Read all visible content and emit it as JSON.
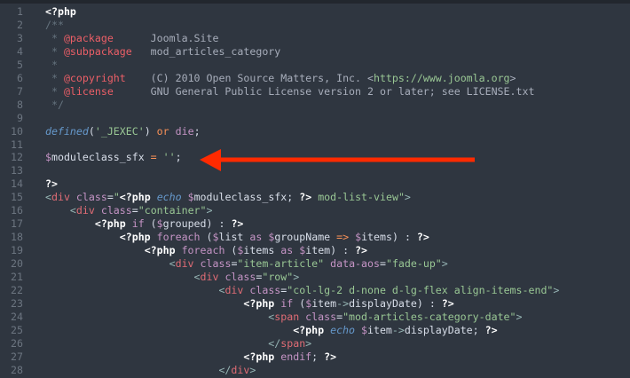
{
  "editor": {
    "line_numbers": [
      "1",
      "2",
      "3",
      "4",
      "5",
      "6",
      "7",
      "8",
      "9",
      "10",
      "11",
      "12",
      "13",
      "14",
      "15",
      "16",
      "17",
      "18",
      "19",
      "20",
      "21",
      "22",
      "23",
      "24",
      "25",
      "26",
      "27",
      "28"
    ],
    "lines": [
      [
        [
          "w",
          "<?php"
        ]
      ],
      [
        [
          "c",
          "/**"
        ]
      ],
      [
        [
          "c",
          " * "
        ],
        [
          "ct",
          "@package"
        ],
        [
          "cv",
          "      Joomla.Site"
        ]
      ],
      [
        [
          "c",
          " * "
        ],
        [
          "ct",
          "@subpackage"
        ],
        [
          "cv",
          "   mod_articles_category"
        ]
      ],
      [
        [
          "c",
          " *"
        ]
      ],
      [
        [
          "c",
          " * "
        ],
        [
          "ct",
          "@copyright"
        ],
        [
          "cv",
          "    (C) 2010 Open Source Matters, Inc. <"
        ],
        [
          "s",
          "https://www.joomla.org"
        ],
        [
          "cv",
          ">"
        ]
      ],
      [
        [
          "c",
          " * "
        ],
        [
          "ct",
          "@license"
        ],
        [
          "cv",
          "      GNU General Public License version 2 or later; see LICENSE.txt"
        ]
      ],
      [
        [
          "c",
          " */"
        ]
      ],
      [],
      [
        [
          "f",
          "defined"
        ],
        [
          "n",
          "("
        ],
        [
          "s",
          "'_JEXEC'"
        ],
        [
          "n",
          ") "
        ],
        [
          "o",
          "or"
        ],
        [
          "n",
          " "
        ],
        [
          "k",
          "die"
        ],
        [
          "n",
          ";"
        ]
      ],
      [],
      [
        [
          "v",
          "$"
        ],
        [
          "n",
          "moduleclass_sfx "
        ],
        [
          "o",
          "="
        ],
        [
          "n",
          " "
        ],
        [
          "s",
          "''"
        ],
        [
          "n",
          ";"
        ]
      ],
      [],
      [
        [
          "w",
          "?>"
        ]
      ],
      [
        [
          "p",
          "<"
        ],
        [
          "t",
          "div"
        ],
        [
          "n",
          " "
        ],
        [
          "a",
          "class"
        ],
        [
          "n",
          "="
        ],
        [
          "s",
          "\""
        ],
        [
          "w",
          "<?php"
        ],
        [
          "n",
          " "
        ],
        [
          "f",
          "echo"
        ],
        [
          "n",
          " "
        ],
        [
          "v",
          "$"
        ],
        [
          "n",
          "moduleclass_sfx; "
        ],
        [
          "w",
          "?>"
        ],
        [
          "s",
          " mod-list-view\""
        ],
        [
          "p",
          ">"
        ]
      ],
      [
        [
          "n",
          "    "
        ],
        [
          "p",
          "<"
        ],
        [
          "t",
          "div"
        ],
        [
          "n",
          " "
        ],
        [
          "a",
          "class"
        ],
        [
          "n",
          "="
        ],
        [
          "s",
          "\"container\""
        ],
        [
          "p",
          ">"
        ]
      ],
      [
        [
          "n",
          "        "
        ],
        [
          "w",
          "<?php"
        ],
        [
          "n",
          " "
        ],
        [
          "k",
          "if"
        ],
        [
          "n",
          " ("
        ],
        [
          "v",
          "$"
        ],
        [
          "n",
          "grouped) : "
        ],
        [
          "w",
          "?>"
        ]
      ],
      [
        [
          "n",
          "            "
        ],
        [
          "w",
          "<?php"
        ],
        [
          "n",
          " "
        ],
        [
          "k",
          "foreach"
        ],
        [
          "n",
          " ("
        ],
        [
          "v",
          "$"
        ],
        [
          "n",
          "list "
        ],
        [
          "k",
          "as"
        ],
        [
          "n",
          " "
        ],
        [
          "v",
          "$"
        ],
        [
          "n",
          "groupName "
        ],
        [
          "o",
          "=>"
        ],
        [
          "n",
          " "
        ],
        [
          "v",
          "$"
        ],
        [
          "n",
          "items) : "
        ],
        [
          "w",
          "?>"
        ]
      ],
      [
        [
          "n",
          "                "
        ],
        [
          "w",
          "<?php"
        ],
        [
          "n",
          " "
        ],
        [
          "k",
          "foreach"
        ],
        [
          "n",
          " ("
        ],
        [
          "v",
          "$"
        ],
        [
          "n",
          "items "
        ],
        [
          "k",
          "as"
        ],
        [
          "n",
          " "
        ],
        [
          "v",
          "$"
        ],
        [
          "n",
          "item) : "
        ],
        [
          "w",
          "?>"
        ]
      ],
      [
        [
          "n",
          "                    "
        ],
        [
          "p",
          "<"
        ],
        [
          "t",
          "div"
        ],
        [
          "n",
          " "
        ],
        [
          "a",
          "class"
        ],
        [
          "n",
          "="
        ],
        [
          "s",
          "\"item-article\""
        ],
        [
          "n",
          " "
        ],
        [
          "a",
          "data-aos"
        ],
        [
          "n",
          "="
        ],
        [
          "s",
          "\"fade-up\""
        ],
        [
          "p",
          ">"
        ]
      ],
      [
        [
          "n",
          "                        "
        ],
        [
          "p",
          "<"
        ],
        [
          "t",
          "div"
        ],
        [
          "n",
          " "
        ],
        [
          "a",
          "class"
        ],
        [
          "n",
          "="
        ],
        [
          "s",
          "\"row\""
        ],
        [
          "p",
          ">"
        ]
      ],
      [
        [
          "n",
          "                            "
        ],
        [
          "p",
          "<"
        ],
        [
          "t",
          "div"
        ],
        [
          "n",
          " "
        ],
        [
          "a",
          "class"
        ],
        [
          "n",
          "="
        ],
        [
          "s",
          "\"col-lg-2 d-none d-lg-flex align-items-end\""
        ],
        [
          "p",
          ">"
        ]
      ],
      [
        [
          "n",
          "                                "
        ],
        [
          "w",
          "<?php"
        ],
        [
          "n",
          " "
        ],
        [
          "k",
          "if"
        ],
        [
          "n",
          " ("
        ],
        [
          "v",
          "$"
        ],
        [
          "n",
          "item"
        ],
        [
          "p",
          "->"
        ],
        [
          "n",
          "displayDate) : "
        ],
        [
          "w",
          "?>"
        ]
      ],
      [
        [
          "n",
          "                                    "
        ],
        [
          "p",
          "<"
        ],
        [
          "t",
          "span"
        ],
        [
          "n",
          " "
        ],
        [
          "a",
          "class"
        ],
        [
          "n",
          "="
        ],
        [
          "s",
          "\"mod-articles-category-date\""
        ],
        [
          "p",
          ">"
        ]
      ],
      [
        [
          "n",
          "                                        "
        ],
        [
          "w",
          "<?php"
        ],
        [
          "n",
          " "
        ],
        [
          "f",
          "echo"
        ],
        [
          "n",
          " "
        ],
        [
          "v",
          "$"
        ],
        [
          "n",
          "item"
        ],
        [
          "p",
          "->"
        ],
        [
          "n",
          "displayDate; "
        ],
        [
          "w",
          "?>"
        ]
      ],
      [
        [
          "n",
          "                                    "
        ],
        [
          "p",
          "</"
        ],
        [
          "t",
          "span"
        ],
        [
          "p",
          ">"
        ]
      ],
      [
        [
          "n",
          "                                "
        ],
        [
          "w",
          "<?php"
        ],
        [
          "n",
          " "
        ],
        [
          "k",
          "endif"
        ],
        [
          "n",
          "; "
        ],
        [
          "w",
          "?>"
        ]
      ],
      [
        [
          "n",
          "                            "
        ],
        [
          "p",
          "</"
        ],
        [
          "t",
          "div"
        ],
        [
          "p",
          ">"
        ]
      ]
    ]
  },
  "annotation": {
    "arrow_color": "#ff2a00",
    "points_to_line": 12
  }
}
